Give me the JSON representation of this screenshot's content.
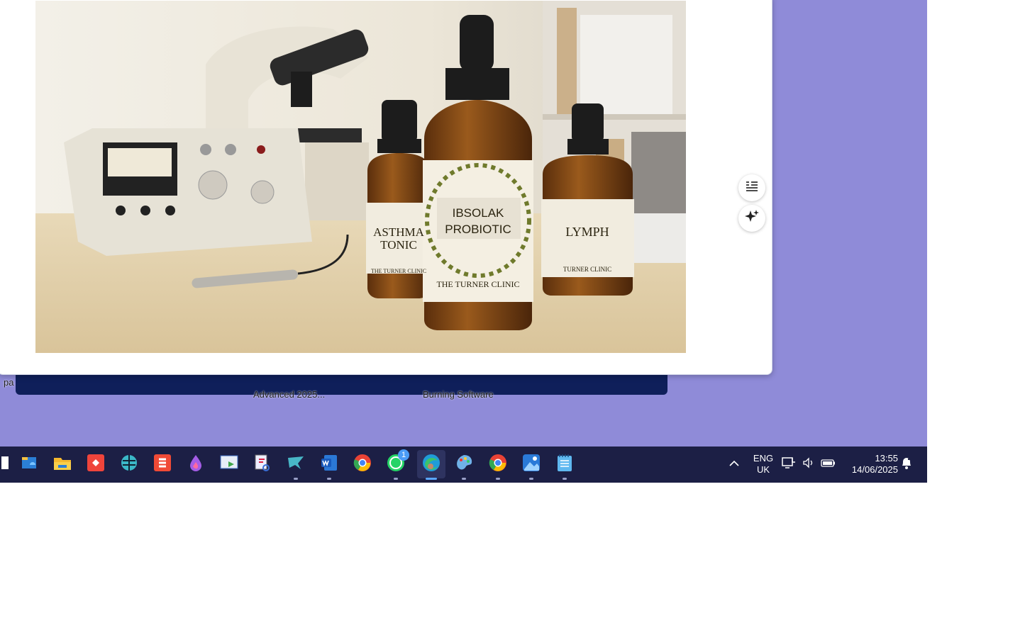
{
  "desktop": {
    "icon_label_left": "pa",
    "icon_label_1": "Advanced 2025...",
    "icon_label_2": "Burning Software"
  },
  "viewer": {
    "bottles": {
      "left_label_line1": "ASTHMA",
      "left_label_line2": "TONIC",
      "left_small": "THE TURNER CLINIC",
      "center_label_line1": "IBSOLAK",
      "center_label_line2": "PROBIOTIC",
      "center_small": "THE TURNER CLINIC",
      "right_label": "LYMPH",
      "right_small": "TURNER CLINIC"
    },
    "side_buttons": [
      "transcript-icon",
      "ai-sparkle-icon"
    ]
  },
  "taskbar": {
    "apps": [
      {
        "name": "start-icon"
      },
      {
        "name": "onedrive-folder-icon"
      },
      {
        "name": "file-explorer-icon"
      },
      {
        "name": "anydesk-icon"
      },
      {
        "name": "network-app-icon"
      },
      {
        "name": "sublime-icon"
      },
      {
        "name": "droplet-app-icon"
      },
      {
        "name": "image-viewer-icon"
      },
      {
        "name": "snipping-tool-icon"
      },
      {
        "name": "bird-app-icon"
      },
      {
        "name": "word-icon"
      },
      {
        "name": "chrome-icon"
      },
      {
        "name": "whatsapp-icon",
        "badge": "1"
      },
      {
        "name": "edge-icon"
      },
      {
        "name": "paint-icon"
      },
      {
        "name": "chrome-profile-icon"
      },
      {
        "name": "photos-icon"
      },
      {
        "name": "notepad-icon"
      }
    ],
    "tray": {
      "language_line1": "ENG",
      "language_line2": "UK",
      "time": "13:55",
      "date": "14/06/2025"
    }
  },
  "colors": {
    "desktop": "#8f8bd8",
    "taskbar": "#1c1f45",
    "back_window": "#0f1f5a"
  }
}
